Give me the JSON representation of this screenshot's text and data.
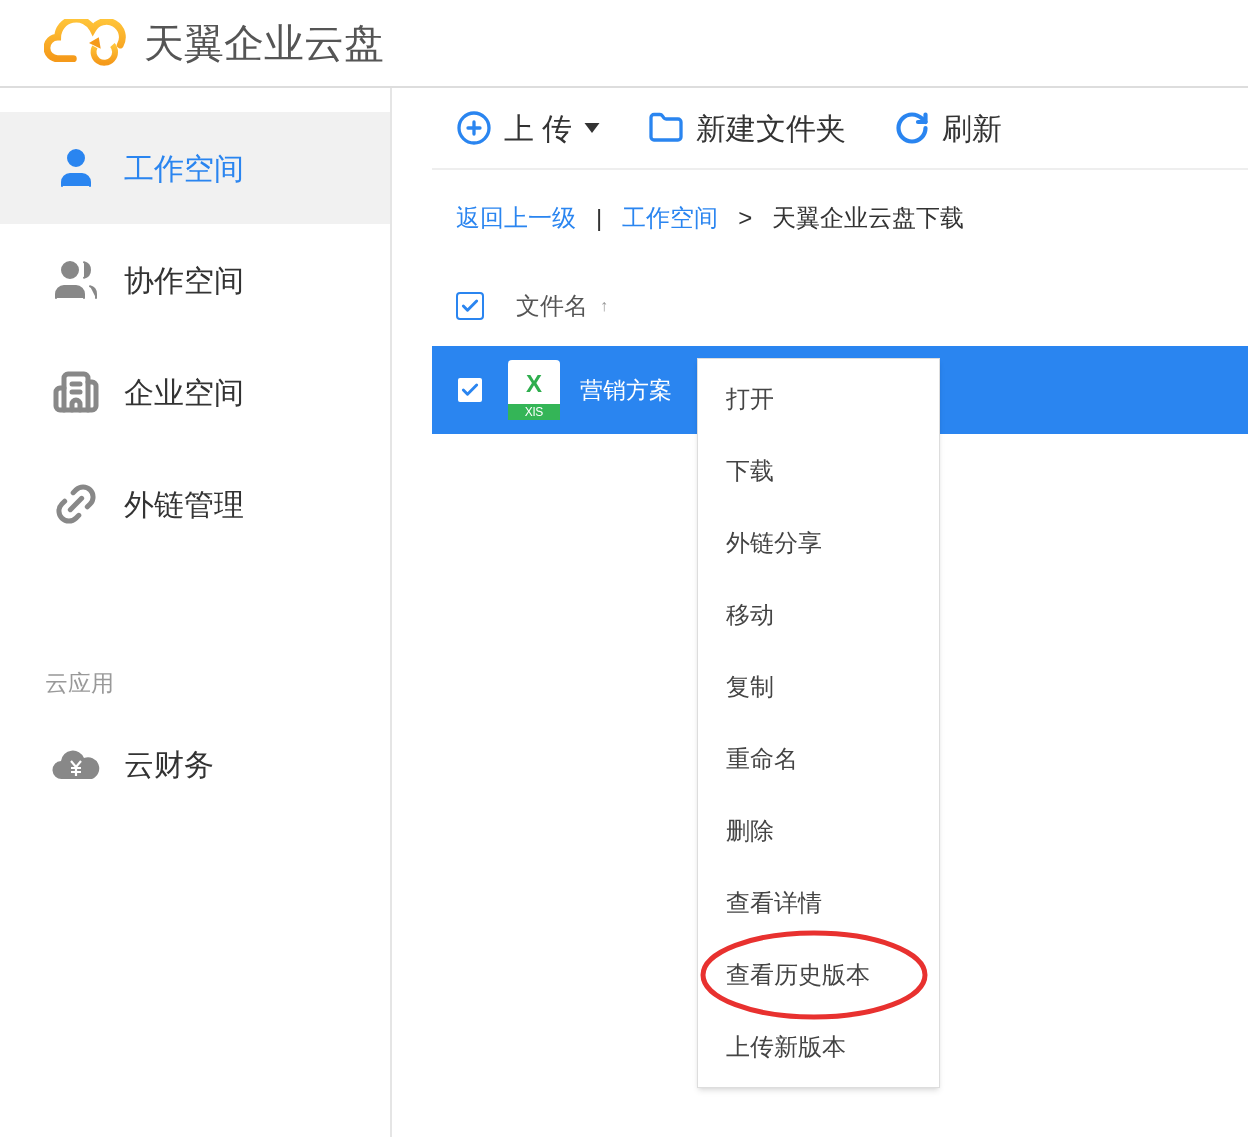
{
  "header": {
    "title": "天翼企业云盘"
  },
  "sidebar": {
    "items": [
      {
        "label": "工作空间",
        "kind": "user",
        "selected": true
      },
      {
        "label": "协作空间",
        "kind": "users",
        "selected": false
      },
      {
        "label": "企业空间",
        "kind": "building",
        "selected": false
      },
      {
        "label": "外链管理",
        "kind": "link",
        "selected": false
      }
    ],
    "section_title": "云应用",
    "apps": [
      {
        "label": "云财务",
        "kind": "finance",
        "selected": false
      }
    ]
  },
  "toolbar": [
    {
      "label": "上 传",
      "kind": "upload",
      "dropdown": true
    },
    {
      "label": "新建文件夹",
      "kind": "folder",
      "dropdown": false
    },
    {
      "label": "刷新",
      "kind": "refresh",
      "dropdown": false
    }
  ],
  "breadcrumb": {
    "back": "返回上一级",
    "separator": "|",
    "path": [
      {
        "label": "工作空间",
        "link": true
      },
      {
        "label": ">",
        "link": false
      },
      {
        "label": "天翼企业云盘下载",
        "link": false
      }
    ]
  },
  "table": {
    "select_all_checked": true,
    "column": "文件名",
    "sort": "↑",
    "rows": [
      {
        "name": "营销方案",
        "icon_letter": "X",
        "icon_label": "XlS",
        "checked": true,
        "selected": true
      }
    ]
  },
  "context_menu": {
    "items": [
      {
        "label": "打开",
        "circled": false
      },
      {
        "label": "下载",
        "circled": false
      },
      {
        "label": "外链分享",
        "circled": false
      },
      {
        "label": "移动",
        "circled": false
      },
      {
        "label": "复制",
        "circled": false
      },
      {
        "label": "重命名",
        "circled": false
      },
      {
        "label": "删除",
        "circled": false
      },
      {
        "label": "查看详情",
        "circled": false
      },
      {
        "label": "查看历史版本",
        "circled": true
      },
      {
        "label": "上传新版本",
        "circled": false
      }
    ]
  }
}
